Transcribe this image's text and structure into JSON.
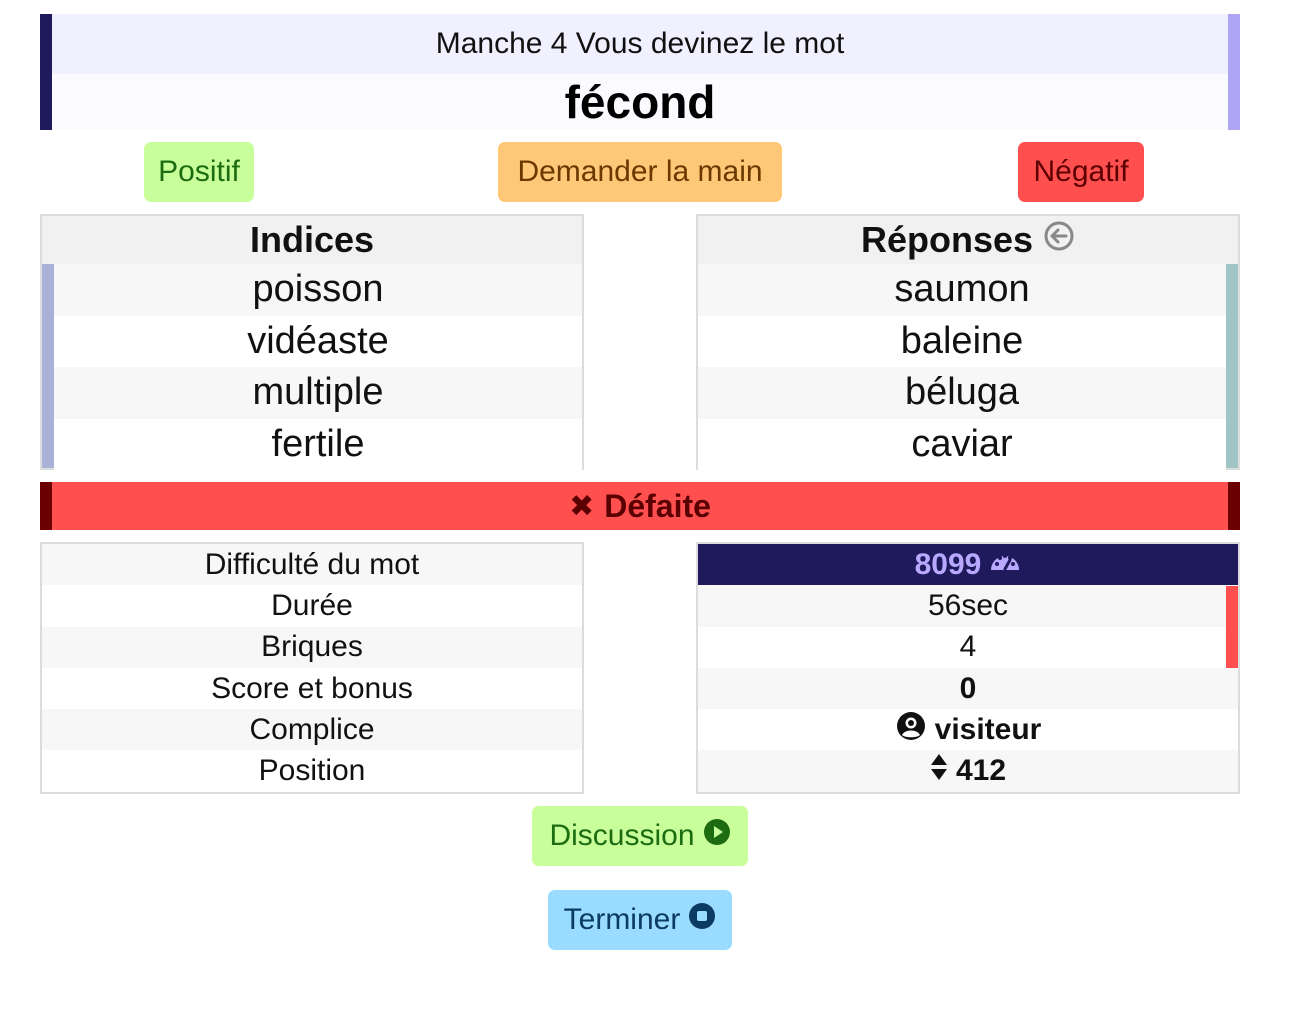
{
  "header": {
    "round_text": "Manche 4 Vous devinez le mot",
    "word": "fécond"
  },
  "actions": {
    "positive_label": "Positif",
    "ask_label": "Demander la main",
    "negative_label": "Négatif"
  },
  "clues": {
    "title": "Indices",
    "items": [
      "poisson",
      "vidéaste",
      "multiple",
      "fertile"
    ]
  },
  "answers": {
    "title": "Réponses",
    "icon": "arrow-left-circle-icon",
    "items": [
      "saumon",
      "baleine",
      "béluga",
      "caviar"
    ]
  },
  "result": {
    "icon": "x-icon",
    "label": "Défaite"
  },
  "stats": {
    "labels": [
      "Difficulté du mot",
      "Durée",
      "Briques",
      "Score et bonus",
      "Complice",
      "Position"
    ],
    "difficulty": "8099",
    "difficulty_icon": "gauge-icon",
    "duration": "56sec",
    "bricks": "4",
    "score": "0",
    "partner": "visiteur",
    "partner_icon": "user-circle-icon",
    "position": "412",
    "position_icon": "sort-icon"
  },
  "footer": {
    "discussion_label": "Discussion",
    "discussion_icon": "play-circle-icon",
    "end_label": "Terminer",
    "end_icon": "stop-circle-icon"
  },
  "colors": {
    "header_dark": "#1e1a5c",
    "header_light": "#aea5f5",
    "positive": "#c8ff9a",
    "ask": "#ffc878",
    "negative": "#ff4f4f",
    "end": "#9adcff"
  }
}
